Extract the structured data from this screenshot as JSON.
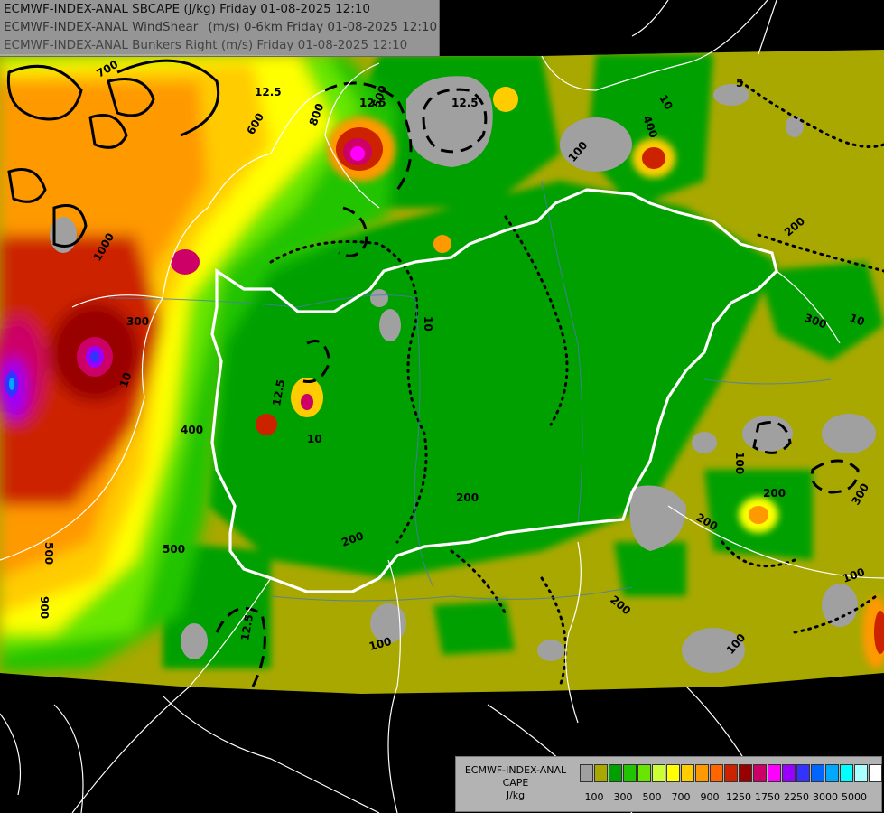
{
  "header": {
    "line1": "ECMWF-INDEX-ANAL SBCAPE (J/kg) Friday 01-08-2025 12:10",
    "line2": "ECMWF-INDEX-ANAL WindShear_ (m/s) 0-6km Friday 01-08-2025 12:10",
    "line3": "ECMWF-INDEX-ANAL Bunkers Right (m/s) Friday 01-08-2025 12:10"
  },
  "legend": {
    "title_line1": "ECMWF-INDEX-ANAL",
    "title_line2": "CAPE",
    "title_line3": "J/kg",
    "colors": [
      "#a0a0a0",
      "#a8a800",
      "#00a000",
      "#22c400",
      "#66e600",
      "#ccff33",
      "#ffff00",
      "#ffcc00",
      "#ff9900",
      "#ff6600",
      "#cc2200",
      "#990000",
      "#cc0066",
      "#ff00ff",
      "#9900ff",
      "#3333ff",
      "#0066ff",
      "#00a8ff",
      "#00ffff",
      "#aaffff",
      "#ffffff"
    ],
    "ticks": [
      "100",
      "300",
      "500",
      "700",
      "900",
      "1250",
      "1750",
      "2250",
      "3000",
      "5000"
    ]
  },
  "map_labels": {
    "contour_values": [
      "12.5",
      "12.5",
      "12.5",
      "12.5",
      "12.5",
      "10",
      "10",
      "10",
      "10",
      "10",
      "5",
      "200",
      "200",
      "200",
      "200",
      "200",
      "200",
      "300",
      "300",
      "300",
      "400",
      "400",
      "500",
      "500",
      "500",
      "600",
      "700",
      "800",
      "900",
      "1000",
      "100",
      "100",
      "100",
      "100",
      "100"
    ]
  },
  "colors": {
    "background": "#000000",
    "border": "#ffffff",
    "low_cape": "#a8a800",
    "no_cape": "#a0a0a0"
  }
}
